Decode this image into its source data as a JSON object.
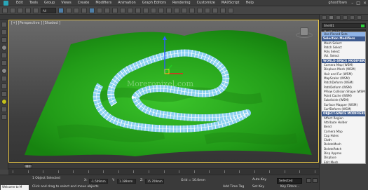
{
  "menu": {
    "items": [
      "Edit",
      "Tools",
      "Group",
      "Views",
      "Create",
      "Modifiers",
      "Animation",
      "Graph Editors",
      "Rendering",
      "Customize",
      "MAXScript",
      "Help"
    ],
    "workspace": "ghostTown"
  },
  "toolbar": {
    "selection_filter": "All"
  },
  "viewport": {
    "label": "[+] [Perspective ] [Shaded ]",
    "watermark": "Moreropixel.com"
  },
  "command_panel": {
    "object_name": "Shell01",
    "modifier_list_label": "Modifier List",
    "object_color": "#2ad13a",
    "modifiers": [
      {
        "label": "Use Pinned Sets",
        "kind": "item"
      },
      {
        "label": "Selection Modifiers",
        "kind": "header"
      },
      {
        "label": "Mesh Select",
        "kind": "item"
      },
      {
        "label": "Patch Select",
        "kind": "item"
      },
      {
        "label": "Poly Select",
        "kind": "item"
      },
      {
        "label": "Vol. Select",
        "kind": "item"
      },
      {
        "label": "WORLD-SPACE MODIFIERS",
        "kind": "header"
      },
      {
        "label": "Camera Map (WSM)",
        "kind": "item"
      },
      {
        "label": "Displace Mesh (WSM)",
        "kind": "item"
      },
      {
        "label": "Hair and Fur (WSM)",
        "kind": "item"
      },
      {
        "label": "MapScaler (WSM)",
        "kind": "item"
      },
      {
        "label": "PatchDeform (WSM)",
        "kind": "item"
      },
      {
        "label": "PathDeform (WSM)",
        "kind": "item"
      },
      {
        "label": "PFlow Collision Shape (WSM)",
        "kind": "item"
      },
      {
        "label": "Point Cache (WSM)",
        "kind": "item"
      },
      {
        "label": "Subdivide (WSM)",
        "kind": "item"
      },
      {
        "label": "Surface Mapper (WSM)",
        "kind": "item"
      },
      {
        "label": "SurfDeform (WSM)",
        "kind": "item"
      },
      {
        "label": "OBJECT-SPACE MODIFIERS",
        "kind": "header"
      },
      {
        "label": "Affect Region",
        "kind": "item"
      },
      {
        "label": "Attribute Holder",
        "kind": "item"
      },
      {
        "label": "Bend",
        "kind": "item"
      },
      {
        "label": "Camera Map",
        "kind": "item"
      },
      {
        "label": "Cap Holes",
        "kind": "item"
      },
      {
        "label": "Cloth",
        "kind": "item"
      },
      {
        "label": "DeleteMesh",
        "kind": "item"
      },
      {
        "label": "DeletePatch",
        "kind": "item"
      },
      {
        "label": "Disp Approx",
        "kind": "item"
      },
      {
        "label": "Displace",
        "kind": "item"
      },
      {
        "label": "Edit Mesh",
        "kind": "item"
      },
      {
        "label": "Edit Normals",
        "kind": "item"
      },
      {
        "label": "Edit Patch",
        "kind": "item"
      },
      {
        "label": "Edit Poly",
        "kind": "item"
      }
    ]
  },
  "timeline": {
    "frame_readout": "0 / 100",
    "tick_labels": [
      "0",
      "5",
      "10",
      "15",
      "20",
      "25",
      "30",
      "35",
      "40",
      "45",
      "50",
      "55",
      "60",
      "65",
      "70",
      "75",
      "80",
      "85",
      "90",
      "95",
      "100"
    ]
  },
  "status": {
    "maxscript": "Welcome to M",
    "line1": "1 Object Selected",
    "line2": "Click and drag to select and move objects",
    "x_label": "X:",
    "x_value": "-1.509mm",
    "y_label": "Y:",
    "y_value": "1.189mm",
    "z_label": "Z:",
    "z_value": "15.709mm",
    "grid": "Grid = 10.0mm",
    "auto_key": "Auto Key",
    "selected": "Selected",
    "set_key": "Set Key",
    "key_filters": "Key Filters...",
    "add_time_tag": "Add Time Tag"
  }
}
